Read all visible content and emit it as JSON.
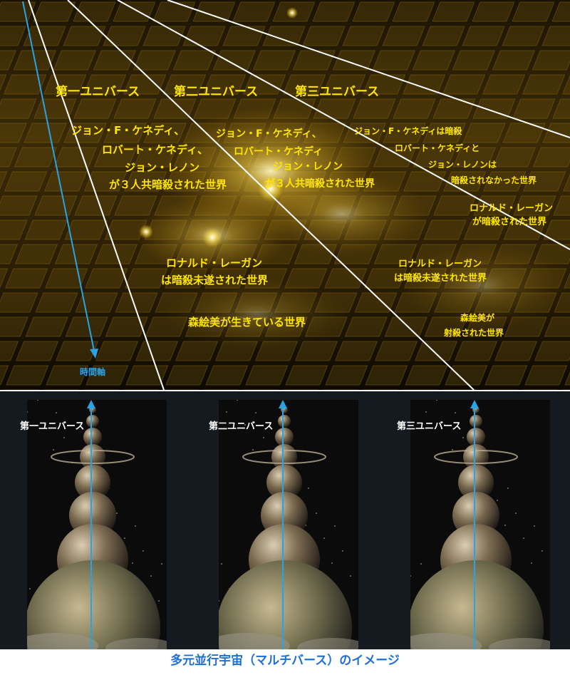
{
  "top_diagram": {
    "universe_headers": [
      "第一ユニバース",
      "第二ユニバース",
      "第三ユニバース"
    ],
    "universe1_events": [
      "ジョン・F・ケネディ、",
      "ロバート・ケネディ、",
      "ジョン・レノン",
      "が３人共暗殺された世界",
      "ロナルド・レーガン",
      "は暗殺未遂された世界",
      "森絵美が生きている世界"
    ],
    "universe2_events": [
      "ジョン・F・ケネディ、",
      "ロバート・ケネディ",
      "ジョン・レノン",
      "が３人共暗殺された世界",
      "ロナルド・レーガン",
      "は暗殺未遂された世界"
    ],
    "universe3_events": [
      "ジョン・F・ケネディは暗殺",
      "ロバート・ケネディと",
      "ジョン・レノンは",
      "暗殺されなかった世界",
      "ロナルド・レーガン",
      "が暗殺された世界",
      "森絵美が",
      "射殺された世界"
    ],
    "time_axis_label": "時間軸"
  },
  "bottom_panels": [
    {
      "label": "第一ユニバース"
    },
    {
      "label": "第二ユニバース"
    },
    {
      "label": "第三ユニバース"
    }
  ],
  "caption": "多元並行宇宙（マルチバース）のイメージ",
  "colors": {
    "label_yellow": "#ffe600",
    "arrow_blue": "#29a3e3",
    "caption_blue": "#1e6fd1",
    "background_dark": "#0d0a04"
  }
}
